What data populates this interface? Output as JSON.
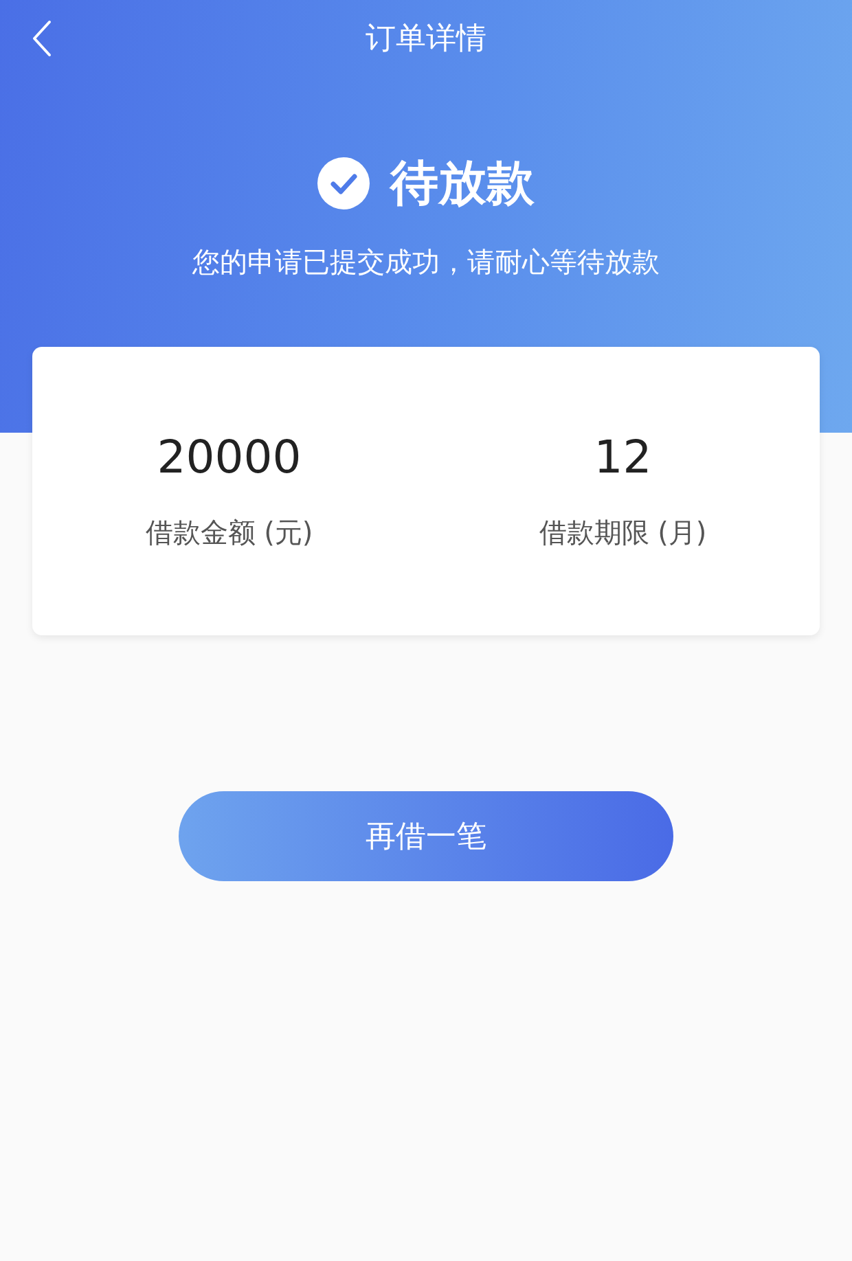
{
  "nav_bar": {
    "title": "订单详情"
  },
  "status": {
    "title": "待放款",
    "message": "您的申请已提交成功，请耐心等待放款"
  },
  "summary": [
    {
      "value": "20000",
      "label": "借款金额 (元)"
    },
    {
      "value": "12",
      "label": "借款期限 (月)"
    }
  ],
  "action_button": {
    "label": "再借一笔"
  }
}
